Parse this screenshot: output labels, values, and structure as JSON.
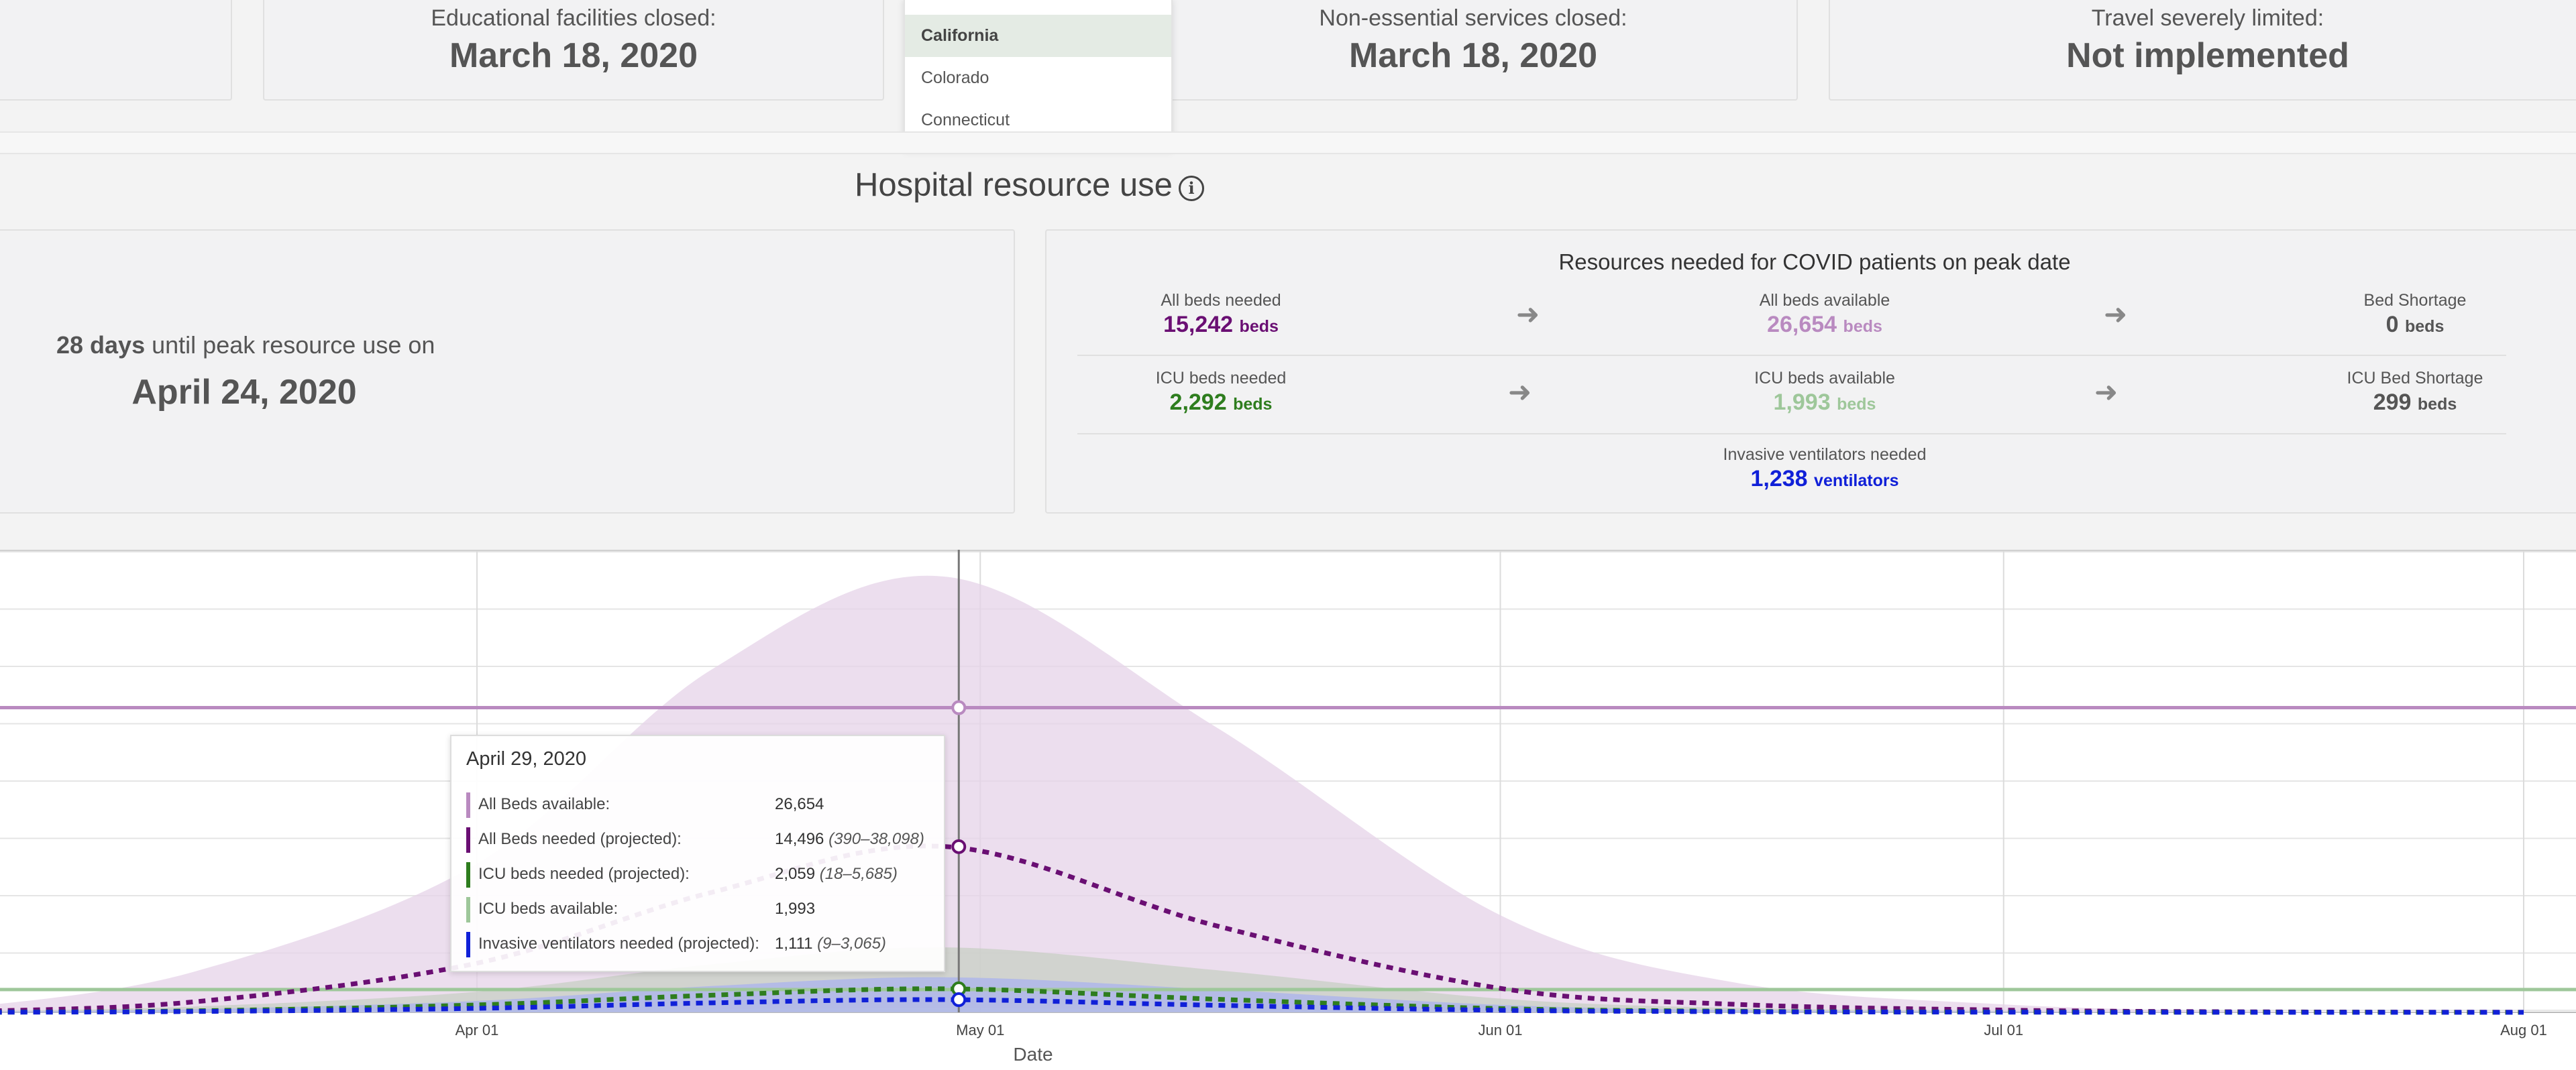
{
  "top_cards": [
    {
      "label": "",
      "value": ""
    },
    {
      "label": "Educational facilities closed:",
      "value": "March 18, 2020"
    },
    {
      "label": "Non-essential services closed:",
      "value": "March 18, 2020"
    },
    {
      "label": "Travel severely limited:",
      "value": "Not implemented"
    }
  ],
  "state_dropdown": {
    "options": [
      "California",
      "Colorado",
      "Connecticut"
    ],
    "selected": "California"
  },
  "section": {
    "title": "Hospital resource use",
    "info_icon": "i"
  },
  "peak": {
    "days": "28 days",
    "text": "until peak resource use on",
    "date": "April 24, 2020"
  },
  "resources": {
    "title": "Resources needed for COVID patients on peak date",
    "all_beds_needed": {
      "label": "All beds needed",
      "value": "15,242",
      "unit": "beds"
    },
    "all_beds_available": {
      "label": "All beds available",
      "value": "26,654",
      "unit": "beds"
    },
    "bed_shortage": {
      "label": "Bed Shortage",
      "value": "0",
      "unit": "beds"
    },
    "icu_beds_needed": {
      "label": "ICU beds needed",
      "value": "2,292",
      "unit": "beds"
    },
    "icu_beds_available": {
      "label": "ICU beds available",
      "value": "1,993",
      "unit": "beds"
    },
    "icu_bed_shortage": {
      "label": "ICU Bed Shortage",
      "value": "299",
      "unit": "beds"
    },
    "ventilators_needed": {
      "label": "Invasive ventilators needed",
      "value": "1,238",
      "unit": "ventilators"
    },
    "arrow": "➜"
  },
  "colors": {
    "all_beds": "#6a0f73",
    "all_beds_available": "#b98ac0",
    "icu_needed": "#2e7d1e",
    "icu_available": "#9ec79a",
    "ventilators": "#1020d8"
  },
  "tooltip": {
    "date": "April 29, 2020",
    "rows": [
      {
        "label": "All Beds available:",
        "value": "26,654",
        "range": ""
      },
      {
        "label": "All Beds needed (projected):",
        "value": "14,496",
        "range": "(390–38,098)"
      },
      {
        "label": "ICU beds needed (projected):",
        "value": "2,059",
        "range": "(18–5,685)"
      },
      {
        "label": "ICU beds available:",
        "value": "1,993",
        "range": ""
      },
      {
        "label": "Invasive ventilators needed (projected):",
        "value": "1,111",
        "range": "(9–3,065)"
      }
    ]
  },
  "chart_data": {
    "type": "area",
    "xlabel": "Date",
    "ylabel": "",
    "x_ticks": [
      "Apr 01",
      "May 01",
      "Jun 01",
      "Jul 01",
      "Aug 01"
    ],
    "ylim": [
      0,
      40000
    ],
    "grid": true,
    "hover_date": "May 01",
    "series": [
      {
        "name": "All Beds available",
        "kind": "line",
        "x": [
          "Mar 01",
          "Aug 01"
        ],
        "values": [
          26654,
          26654
        ]
      },
      {
        "name": "ICU beds available",
        "kind": "line",
        "x": [
          "Mar 01",
          "Aug 01"
        ],
        "values": [
          1993,
          1993
        ]
      },
      {
        "name": "All Beds needed (projected)",
        "kind": "dashed-with-band",
        "x": [
          "Mar 01",
          "Mar 15",
          "Apr 01",
          "Apr 15",
          "Apr 29",
          "May 15",
          "Jun 01",
          "Jun 15",
          "Jul 01",
          "Jul 15",
          "Aug 01"
        ],
        "values": [
          50,
          900,
          4300,
          10500,
          14496,
          7600,
          2100,
          700,
          200,
          50,
          10
        ],
        "upper": [
          300,
          3500,
          13000,
          30000,
          38098,
          25000,
          8500,
          2600,
          700,
          120,
          20
        ],
        "lower": [
          0,
          20,
          120,
          280,
          390,
          200,
          60,
          20,
          5,
          0,
          0
        ]
      },
      {
        "name": "ICU beds needed (projected)",
        "kind": "dashed-with-band",
        "x": [
          "Mar 01",
          "Mar 15",
          "Apr 01",
          "Apr 15",
          "Apr 29",
          "May 15",
          "Jun 01",
          "Jun 15",
          "Jul 01",
          "Jul 15",
          "Aug 01"
        ],
        "values": [
          5,
          130,
          650,
          1500,
          2059,
          1150,
          330,
          100,
          30,
          8,
          2
        ],
        "upper": [
          40,
          500,
          1800,
          4200,
          5685,
          3700,
          1200,
          380,
          110,
          20,
          5
        ],
        "lower": [
          0,
          2,
          6,
          12,
          18,
          10,
          4,
          1,
          0,
          0,
          0
        ]
      },
      {
        "name": "Invasive ventilators needed (projected)",
        "kind": "dashed-with-band",
        "x": [
          "Mar 01",
          "Mar 15",
          "Apr 01",
          "Apr 15",
          "Apr 29",
          "May 15",
          "Jun 01",
          "Jun 15",
          "Jul 01",
          "Jul 15",
          "Aug 01"
        ],
        "values": [
          3,
          70,
          350,
          830,
          1111,
          620,
          180,
          55,
          15,
          4,
          1
        ],
        "upper": [
          20,
          270,
          1000,
          2300,
          3065,
          2000,
          650,
          200,
          60,
          12,
          3
        ],
        "lower": [
          0,
          1,
          3,
          6,
          9,
          5,
          2,
          0,
          0,
          0,
          0
        ]
      }
    ]
  }
}
